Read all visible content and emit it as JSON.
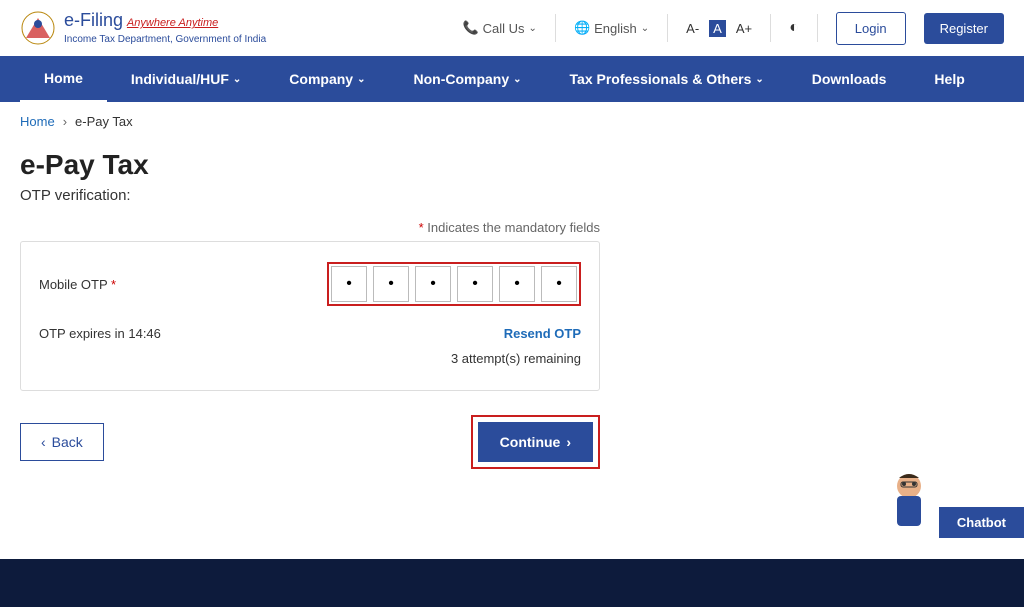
{
  "header": {
    "brand": "e-Filing",
    "tagline": "Anywhere Anytime",
    "subtext": "Income Tax Department, Government of India",
    "call_us": "Call Us",
    "language": "English",
    "font_small": "A-",
    "font_medium": "A",
    "font_large": "A+",
    "login": "Login",
    "register": "Register"
  },
  "nav": {
    "home": "Home",
    "individual": "Individual/HUF",
    "company": "Company",
    "noncompany": "Non-Company",
    "tax_professionals": "Tax Professionals & Others",
    "downloads": "Downloads",
    "help": "Help"
  },
  "breadcrumb": {
    "home": "Home",
    "current": "e-Pay Tax"
  },
  "page": {
    "title": "e-Pay Tax",
    "subtitle": "OTP verification:",
    "mandatory_note": "Indicates the mandatory fields"
  },
  "otp": {
    "label": "Mobile OTP",
    "expire_prefix": "OTP expires in ",
    "expire_time": "14:46",
    "resend": "Resend OTP",
    "attempts": "3 attempt(s) remaining",
    "values": [
      "•",
      "•",
      "•",
      "•",
      "•",
      "•"
    ]
  },
  "actions": {
    "back": "Back",
    "continue": "Continue"
  },
  "chatbot": {
    "label": "Chatbot"
  }
}
